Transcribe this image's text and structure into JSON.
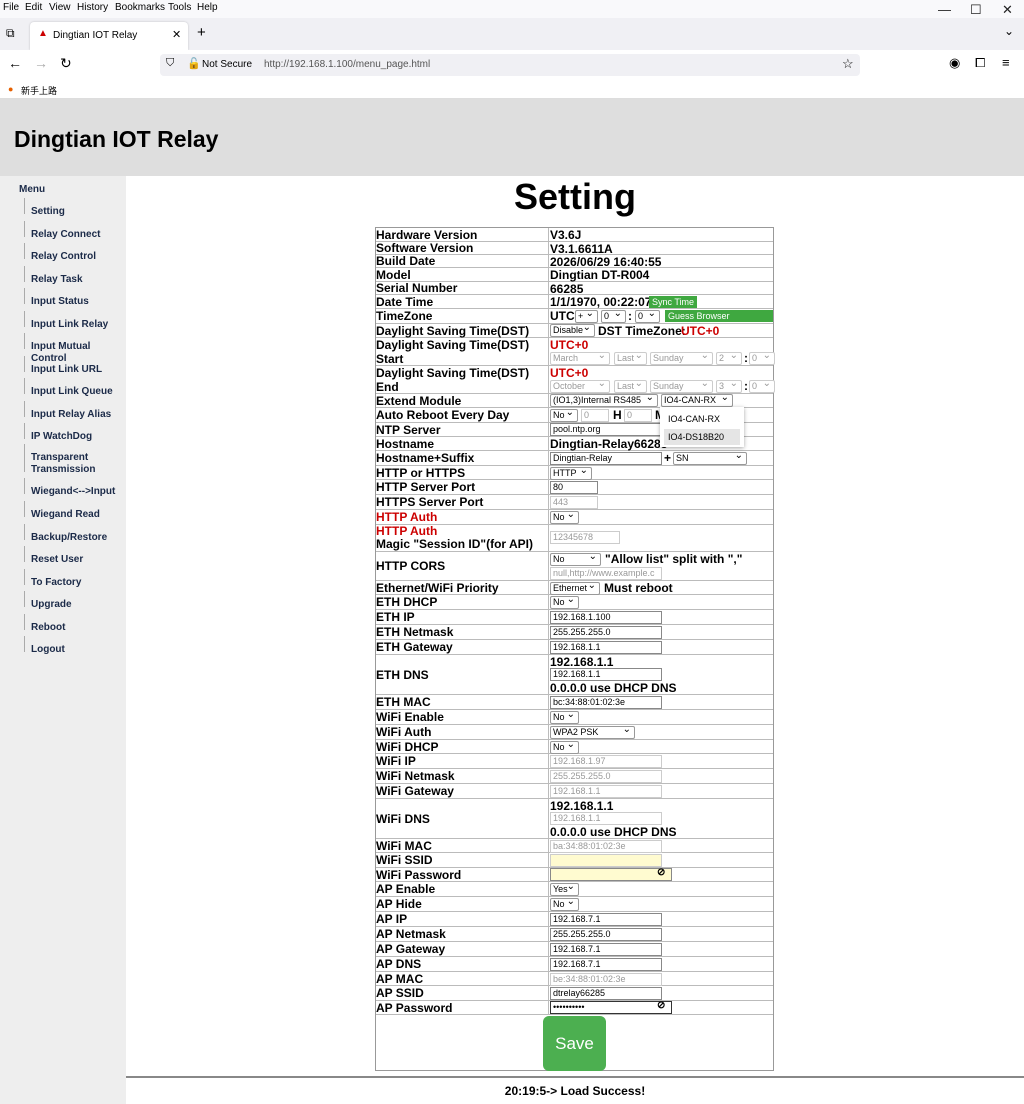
{
  "browser": {
    "menu": [
      "File",
      "Edit",
      "View",
      "History",
      "Bookmarks",
      "Tools",
      "Help"
    ],
    "tab_title": "Dingtian IOT Relay",
    "not_secure": "Not Secure",
    "url": "http://192.168.1.100/menu_page.html",
    "bookmark": "新手上路"
  },
  "header": {
    "title": "Dingtian IOT Relay"
  },
  "sidebar": {
    "heading": "Menu",
    "items": [
      "Setting",
      "Relay Connect",
      "Relay Control",
      "Relay Task",
      "Input Status",
      "Input Link Relay",
      "Input Mutual Control",
      "Input Link URL",
      "Input Link Queue",
      "Input Relay Alias",
      "IP WatchDog",
      "Transparent Transmission",
      "Wiegand<-->Input",
      "Wiegand Read",
      "Backup/Restore",
      "Reset User",
      "To Factory",
      "Upgrade",
      "Reboot",
      "Logout"
    ]
  },
  "page": {
    "title": "Setting"
  },
  "labels": {
    "hw": "Hardware Version",
    "sw": "Software Version",
    "build": "Build Date",
    "model": "Model",
    "serial": "Serial Number",
    "date": "Date Time",
    "tz": "TimeZone",
    "dst": "Daylight Saving Time(DST)",
    "dst_start": "Daylight Saving Time(DST) Start",
    "dst_end": "Daylight Saving Time(DST) End",
    "extend": "Extend Module",
    "auto_reboot": "Auto Reboot Every Day",
    "ntp": "NTP Server",
    "hostname": "Hostname",
    "hostname_suffix": "Hostname+Suffix",
    "http_https": "HTTP or HTTPS",
    "http_port": "HTTP Server Port",
    "https_port": "HTTPS Server Port",
    "http_auth": "HTTP Auth",
    "magic1": "HTTP Auth",
    "magic2": "Magic \"Session ID\"(for API)",
    "cors": "HTTP CORS",
    "priority": "Ethernet/WiFi Priority",
    "eth_dhcp": "ETH DHCP",
    "eth_ip": "ETH IP",
    "eth_netmask": "ETH Netmask",
    "eth_gateway": "ETH Gateway",
    "eth_dns": "ETH DNS",
    "eth_mac": "ETH MAC",
    "wifi_enable": "WiFi Enable",
    "wifi_auth": "WiFi Auth",
    "wifi_dhcp": "WiFi DHCP",
    "wifi_ip": "WiFi IP",
    "wifi_netmask": "WiFi Netmask",
    "wifi_gateway": "WiFi Gateway",
    "wifi_dns": "WiFi DNS",
    "wifi_mac": "WiFi MAC",
    "wifi_ssid": "WiFi SSID",
    "wifi_password": "WiFi Password",
    "ap_enable": "AP Enable",
    "ap_hide": "AP Hide",
    "ap_ip": "AP IP",
    "ap_netmask": "AP Netmask",
    "ap_gateway": "AP Gateway",
    "ap_dns": "AP DNS",
    "ap_mac": "AP MAC",
    "ap_ssid": "AP SSID",
    "ap_password": "AP Password"
  },
  "values": {
    "hw": "V3.6J",
    "sw": "V3.1.6611A",
    "build": "2026/06/29 16:40:55",
    "model": "Dingtian DT-R004",
    "serial": "66285",
    "date": "1/1/1970, 00:22:07",
    "sync_btn": "Sync Time",
    "tz_prefix": "UTC",
    "tz_sign": "+",
    "tz_h": "0",
    "tz_m": "0",
    "colon": ":",
    "guess_btn": "Guess Browser TimeZone",
    "dst_sel": "Disable",
    "dst_tz_label": "DST TimeZone:",
    "dst_tz_val": "UTC+0",
    "dst_start_utc": "UTC+0",
    "dst_start_month": "March",
    "dst_start_week": "Last",
    "dst_start_day": "Sunday",
    "dst_start_h": "2",
    "dst_start_m": "0",
    "dst_end_utc": "UTC+0",
    "dst_end_month": "October",
    "dst_end_week": "Last",
    "dst_end_day": "Sunday",
    "dst_end_h": "3",
    "dst_end_m": "0",
    "ext1": "(IO1,3)Internal RS485",
    "ext2": "IO4-CAN-RX",
    "ext_opts": [
      "IO4-CAN-RX",
      "IO4-DS18B20"
    ],
    "reboot_sel": "No",
    "reboot_h": "0",
    "h_label": "H",
    "reboot_m": "0",
    "m_label": "M",
    "ntp": "pool.ntp.org",
    "hostname": "Dingtian-Relay66285",
    "hostname_base": "Dingtian-Relay",
    "plus": "+",
    "suffix": "SN",
    "http_https": "HTTP",
    "http_port": "80",
    "https_port": "443",
    "http_auth": "No",
    "magic": "12345678",
    "cors": "No",
    "allow_list": "\"Allow list\" split with \",\"",
    "cors_input": "null,http://www.example.c",
    "priority": "Ethernet",
    "must_reboot": "Must reboot",
    "eth_dhcp": "No",
    "eth_ip": "192.168.1.100",
    "eth_netmask": "255.255.255.0",
    "eth_gateway": "192.168.1.1",
    "eth_dns_top": "192.168.1.1",
    "eth_dns": "192.168.1.1",
    "eth_dns_hint": "0.0.0.0 use DHCP DNS",
    "eth_mac": "bc:34:88:01:02:3e",
    "wifi_enable": "No",
    "wifi_auth": "WPA2 PSK",
    "wifi_dhcp": "No",
    "wifi_ip": "192.168.1.97",
    "wifi_netmask": "255.255.255.0",
    "wifi_gateway": "192.168.1.1",
    "wifi_dns_top": "192.168.1.1",
    "wifi_dns": "192.168.1.1",
    "wifi_dns_hint": "0.0.0.0 use DHCP DNS",
    "wifi_mac": "ba:34:88:01:02:3e",
    "wifi_ssid": "",
    "wifi_password": "",
    "ap_enable": "Yes",
    "ap_hide": "No",
    "ap_ip": "192.168.7.1",
    "ap_netmask": "255.255.255.0",
    "ap_gateway": "192.168.7.1",
    "ap_dns": "192.168.7.1",
    "ap_mac": "be:34:88:01:02:3e",
    "ap_ssid": "dtrelay66285",
    "ap_password": "••••••••••"
  },
  "save": "Save",
  "status": "20:19:5-> Load Success!"
}
